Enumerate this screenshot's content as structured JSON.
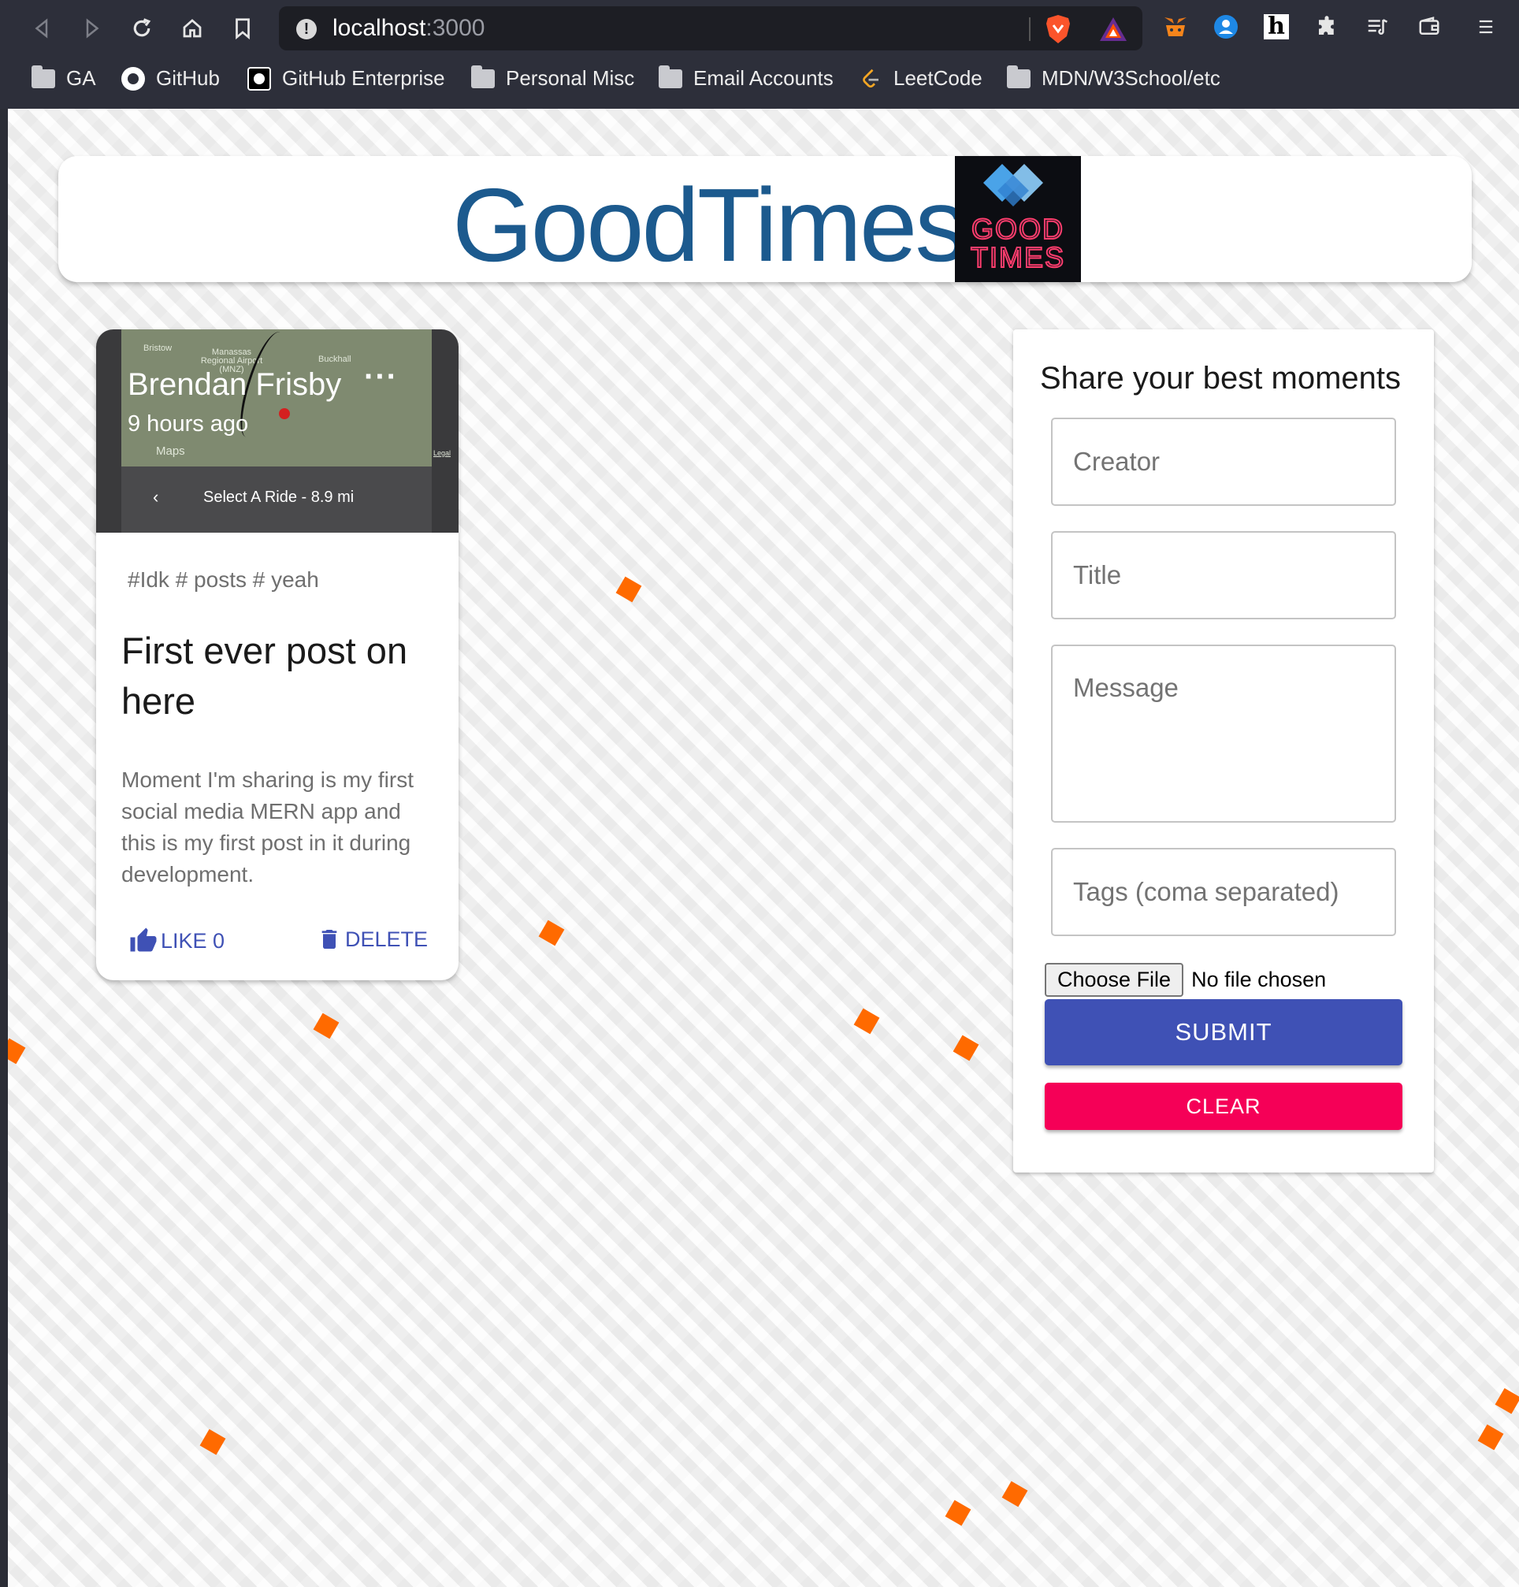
{
  "browser": {
    "url_host": "localhost",
    "url_port": ":3000",
    "bookmarks": [
      {
        "label": "GA",
        "icon": "folder-icon"
      },
      {
        "label": "GitHub",
        "icon": "github-icon"
      },
      {
        "label": "GitHub Enterprise",
        "icon": "github-enterprise-icon"
      },
      {
        "label": "Personal Misc",
        "icon": "folder-icon"
      },
      {
        "label": "Email Accounts",
        "icon": "folder-icon"
      },
      {
        "label": "LeetCode",
        "icon": "leetcode-icon"
      },
      {
        "label": "MDN/W3School/etc",
        "icon": "folder-icon"
      }
    ],
    "extension_h": "h"
  },
  "app": {
    "brand": "GoodTimes",
    "logo_line1": "GOOD",
    "logo_line2": "TIMES",
    "brand_color": "#1c5a8e"
  },
  "post": {
    "media": {
      "map_labels": [
        "Bristow",
        "Manassas Regional Airport (MNZ)",
        "Buckhall",
        "Maps",
        "Legal"
      ],
      "ride_text": "Select A Ride - 8.9 mi",
      "back_glyph": "‹"
    },
    "author": "Brendan Frisby",
    "time": "9 hours ago",
    "more": "···",
    "tags": "#Idk # posts # yeah",
    "title": "First ever post on here",
    "message": "Moment I'm sharing is my first social media MERN app and this is my first post in it during development.",
    "like_label": "LIKE 0",
    "delete_label": "DELETE"
  },
  "form": {
    "title": "Share your best moments",
    "creator_placeholder": "Creator",
    "title_placeholder": "Title",
    "message_placeholder": "Message",
    "tags_placeholder": "Tags (coma separated)",
    "choose_file": "Choose File",
    "file_status": "No file chosen",
    "submit": "SUBMIT",
    "clear": "CLEAR"
  },
  "colors": {
    "primary": "#3f51b5",
    "secondary": "#f50057",
    "accent_decor": "#ff6a00"
  }
}
